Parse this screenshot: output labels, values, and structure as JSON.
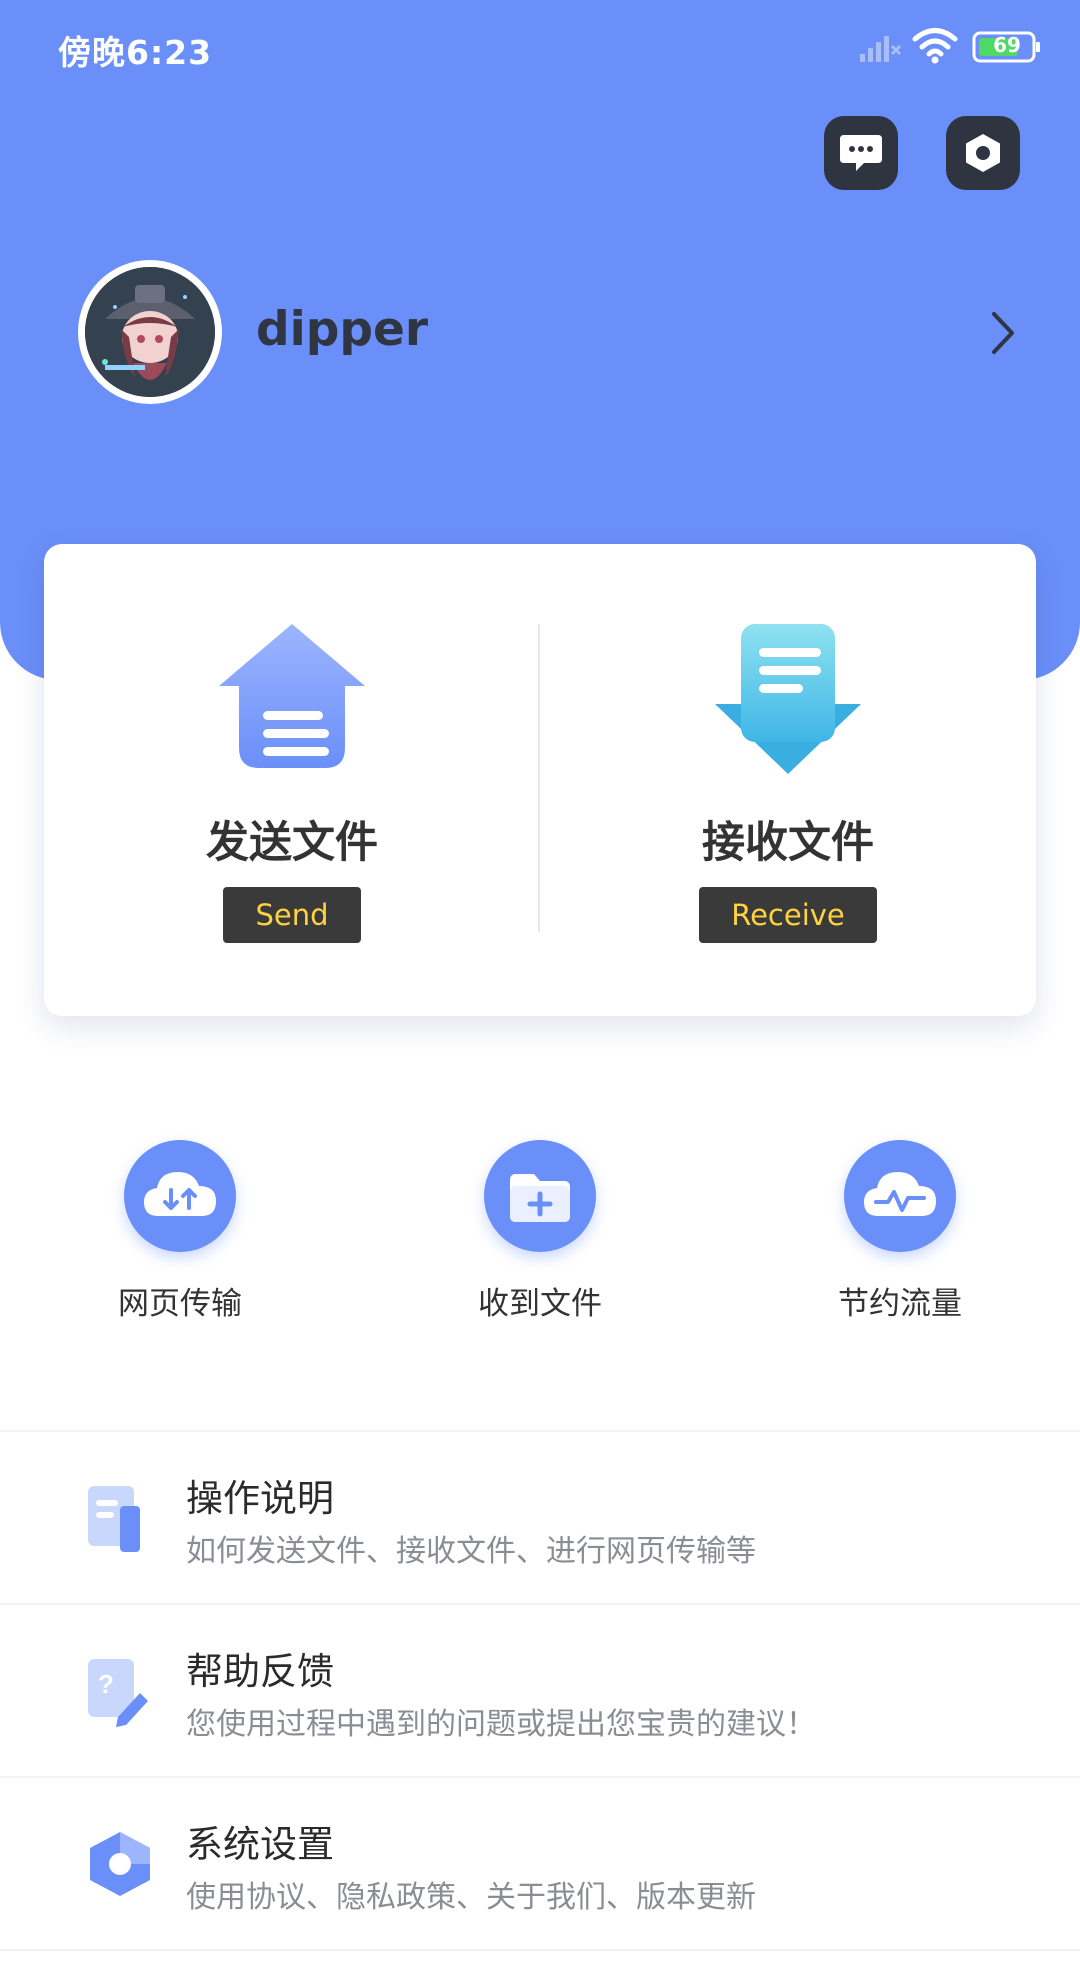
{
  "status_bar": {
    "time": "傍晚6:23",
    "battery": "69"
  },
  "header": {
    "username": "dipper"
  },
  "icons": {
    "message": "chat-bubble-icon",
    "settings": "hexagon-settings-icon",
    "profile": "chevron-right-icon"
  },
  "actions": {
    "send": {
      "title": "发送文件",
      "pill": "Send"
    },
    "receive": {
      "title": "接收文件",
      "pill": "Receive"
    }
  },
  "quick": [
    {
      "label": "网页传输",
      "icon": "cloud-transfer-icon"
    },
    {
      "label": "收到文件",
      "icon": "folder-add-icon"
    },
    {
      "label": "节约流量",
      "icon": "cloud-pulse-icon"
    }
  ],
  "menu": [
    {
      "title": "操作说明",
      "subtitle": "如何发送文件、接收文件、进行网页传输等",
      "icon": "document-icon"
    },
    {
      "title": "帮助反馈",
      "subtitle": "您使用过程中遇到的问题或提出您宝贵的建议！",
      "icon": "feedback-edit-icon"
    },
    {
      "title": "系统设置",
      "subtitle": "使用协议、隐私政策、关于我们、版本更新",
      "icon": "hexagon-settings-icon"
    }
  ],
  "colors": {
    "primary": "#6a8ff8",
    "pill_bg": "#3a3a3a",
    "pill_text": "#ffd23f",
    "battery": "#4cd964"
  }
}
